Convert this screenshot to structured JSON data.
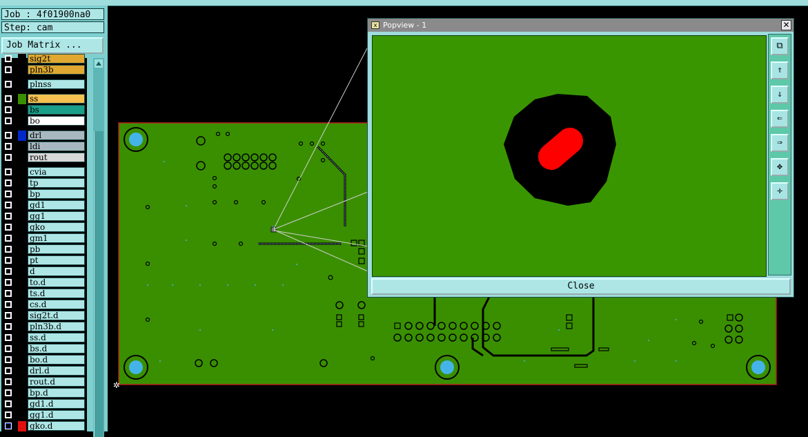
{
  "info": {
    "job": "Job : 4f01900na0",
    "step": "Step: cam",
    "job_matrix": "Job Matrix ..."
  },
  "layers": [
    {
      "name": "sig2t",
      "color": "#e0a830",
      "swatch": "#000"
    },
    {
      "name": "pln3b",
      "color": "#e0a830",
      "swatch": "#000"
    },
    {
      "name": "plnss",
      "color": "#aee6e6",
      "swatch": "#000",
      "gap": true
    },
    {
      "name": "ss",
      "color": "#f5c050",
      "swatch": "#3a8f00",
      "gap": true
    },
    {
      "name": "bs",
      "color": "#1aa08a",
      "swatch": "#000"
    },
    {
      "name": "bo",
      "color": "#ffffff",
      "swatch": "#000"
    },
    {
      "name": "drl",
      "color": "#a8b8c0",
      "swatch": "#0028c8",
      "gap": true
    },
    {
      "name": "ldi",
      "color": "#a8b8c0",
      "swatch": "#000"
    },
    {
      "name": "rout",
      "color": "#d8d8d8",
      "swatch": "#000"
    },
    {
      "name": "cvia",
      "color": "#aee6e6",
      "swatch": "#000",
      "gap": true
    },
    {
      "name": "tp",
      "color": "#aee6e6",
      "swatch": "#000"
    },
    {
      "name": "bp",
      "color": "#aee6e6",
      "swatch": "#000"
    },
    {
      "name": "gd1",
      "color": "#aee6e6",
      "swatch": "#000"
    },
    {
      "name": "gg1",
      "color": "#aee6e6",
      "swatch": "#000"
    },
    {
      "name": "gko",
      "color": "#aee6e6",
      "swatch": "#000"
    },
    {
      "name": "gm1",
      "color": "#aee6e6",
      "swatch": "#000"
    },
    {
      "name": "pb",
      "color": "#aee6e6",
      "swatch": "#000"
    },
    {
      "name": "pt",
      "color": "#aee6e6",
      "swatch": "#000"
    },
    {
      "name": "d",
      "color": "#aee6e6",
      "swatch": "#000"
    },
    {
      "name": "to.d",
      "color": "#aee6e6",
      "swatch": "#000"
    },
    {
      "name": "ts.d",
      "color": "#aee6e6",
      "swatch": "#000"
    },
    {
      "name": "cs.d",
      "color": "#aee6e6",
      "swatch": "#000"
    },
    {
      "name": "sig2t.d",
      "color": "#aee6e6",
      "swatch": "#000"
    },
    {
      "name": "pln3b.d",
      "color": "#aee6e6",
      "swatch": "#000"
    },
    {
      "name": "ss.d",
      "color": "#aee6e6",
      "swatch": "#000"
    },
    {
      "name": "bs.d",
      "color": "#aee6e6",
      "swatch": "#000"
    },
    {
      "name": "bo.d",
      "color": "#aee6e6",
      "swatch": "#000"
    },
    {
      "name": "drl.d",
      "color": "#aee6e6",
      "swatch": "#000"
    },
    {
      "name": "rout.d",
      "color": "#aee6e6",
      "swatch": "#000"
    },
    {
      "name": "bp.d",
      "color": "#aee6e6",
      "swatch": "#000"
    },
    {
      "name": "gd1.d",
      "color": "#aee6e6",
      "swatch": "#000"
    },
    {
      "name": "gg1.d",
      "color": "#aee6e6",
      "swatch": "#000"
    },
    {
      "name": "gko.d",
      "color": "#aee6e6",
      "swatch": "#e01010",
      "active": true
    }
  ],
  "popview": {
    "title": "Popview - 1",
    "close_label": "Close",
    "close_x": "✕"
  },
  "colors": {
    "board": "#3a8f00",
    "outline": "#b81e1e",
    "pad": "#44b4e8",
    "hole": "#000000",
    "highlight": "#ff0000"
  }
}
